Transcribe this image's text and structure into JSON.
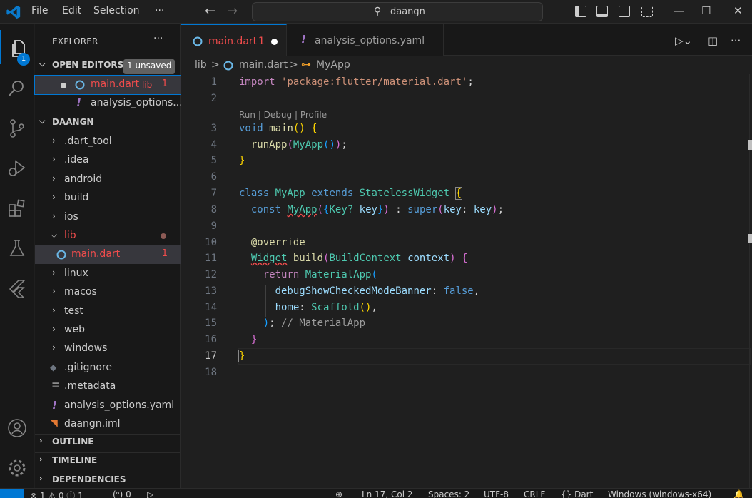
{
  "titlebar": {
    "menu": [
      "File",
      "Edit",
      "Selection",
      "···"
    ],
    "search_text": "daangn"
  },
  "activity": {
    "explorer_badge": "1"
  },
  "sidebar": {
    "title": "EXPLORER",
    "more": "···",
    "open_editors": {
      "header": "OPEN EDITORS",
      "badge": "1 unsaved",
      "items": [
        {
          "name": "main.dart",
          "desc": "lib",
          "count": "1"
        },
        {
          "name": "analysis_options..."
        }
      ]
    },
    "project": {
      "header": "DAANGN",
      "folders": [
        ".dart_tool",
        ".idea",
        "android",
        "build",
        "ios",
        "lib",
        "linux",
        "macos",
        "test",
        "web",
        "windows"
      ],
      "lib_child": {
        "name": "main.dart",
        "count": "1"
      },
      "files": [
        ".gitignore",
        ".metadata",
        "analysis_options.yaml",
        "daangn.iml"
      ]
    },
    "outline": "OUTLINE",
    "timeline": "TIMELINE",
    "dependencies": "DEPENDENCIES"
  },
  "tabs": [
    {
      "label": "main.dart",
      "count": "1",
      "modified": true
    },
    {
      "label": "analysis_options.yaml"
    }
  ],
  "breadcrumbs": [
    "lib",
    ">",
    "main.dart",
    ">",
    "MyApp"
  ],
  "editor": {
    "line_numbers": [
      "1",
      "2",
      "3",
      "4",
      "5",
      "6",
      "7",
      "8",
      "9",
      "10",
      "11",
      "12",
      "13",
      "14",
      "15",
      "16",
      "17",
      "18"
    ],
    "code_lens": "Run | Debug | Profile",
    "code": {
      "l1_kw": "import",
      "l1_str": "'package:flutter/material.dart'",
      "l1_end": ";",
      "l3_kw": "void",
      "l3_fn": "main",
      "l3_p": "()",
      "l3_b": "{",
      "l4_fn": "runApp",
      "l4_p1": "(",
      "l4_ty": "MyApp",
      "l4_p2": "()",
      "l4_p3": ")",
      "l4_end": ";",
      "l5_b": "}",
      "l7_kw": "class",
      "l7_ty": "MyApp",
      "l7_kw2": "extends",
      "l7_ty2": "StatelessWidget",
      "l7_b": "{",
      "l8_kw": "const",
      "l8_ty": "MyApp",
      "l8_p1": "(",
      "l8_b1": "{",
      "l8_ty2": "Key?",
      "l8_var": "key",
      "l8_b2": "}",
      "l8_p2": ")",
      "l8_colon": " : ",
      "l8_kw2": "super",
      "l8_p3": "(",
      "l8_var2": "key",
      "l8_colon2": ": ",
      "l8_var3": "key",
      "l8_p4": ")",
      "l8_end": ";",
      "l10_ann": "@override",
      "l11_ty": "Widget",
      "l11_fn": "build",
      "l11_p1": "(",
      "l11_ty2": "BuildContext",
      "l11_var": "context",
      "l11_p2": ")",
      "l11_b": "{",
      "l12_kw": "return",
      "l12_ty": "MaterialApp",
      "l12_p": "(",
      "l13_var": "debugShowCheckedModeBanner",
      "l13_colon": ": ",
      "l13_kw": "false",
      "l13_end": ",",
      "l14_var": "home",
      "l14_colon": ": ",
      "l14_ty": "Scaffold",
      "l14_p": "()",
      "l14_end": ",",
      "l15_p": ")",
      "l15_end": ";",
      "l15_cm": "// MaterialApp",
      "l16_b": "}",
      "l17_b": "}"
    }
  },
  "statusbar": {
    "problems": "⊗ 1 ⚠ 0 ⓘ 1",
    "ports": "(ᵒ) 0",
    "position": "Ln 17, Col 2",
    "spaces": "Spaces: 2",
    "encoding": "UTF-8",
    "eol": "CRLF",
    "language": "{} Dart",
    "platform": "Windows (windows-x64)"
  },
  "colors": {
    "accent": "#0078d4",
    "error": "#f14c4c",
    "background": "#1f1f1f"
  }
}
